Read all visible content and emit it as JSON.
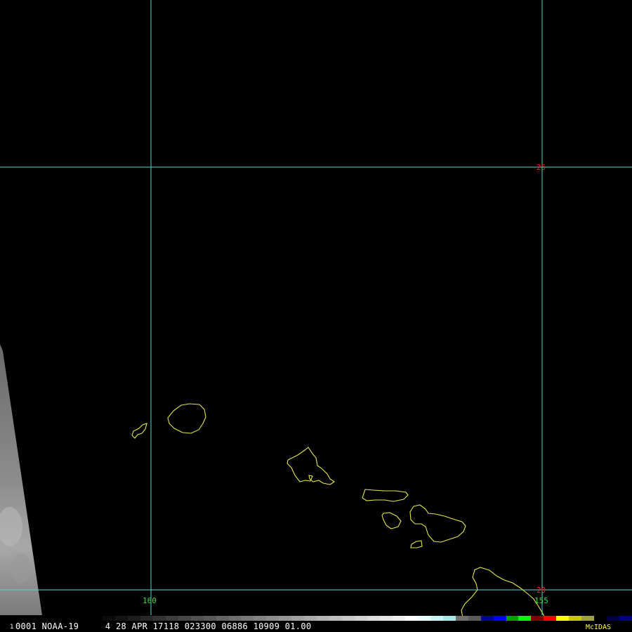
{
  "image": {
    "type": "McIDAS satellite image",
    "background": "#000000",
    "grid_color": "#4fd8d8",
    "coast_color": "#e6e64a",
    "cloud_color": "#8a8a8a"
  },
  "grid": {
    "latitudes": [
      {
        "label": "25",
        "label_color": "#ff2020"
      },
      {
        "label": "20",
        "label_color": "#ff2020"
      }
    ],
    "longitudes": [
      {
        "label": "160",
        "label_color": "#30e030"
      },
      {
        "label": "155",
        "label_color": "#30e030"
      }
    ]
  },
  "islands": [
    "Niihau",
    "Kauai",
    "Oahu",
    "Molokai",
    "Lanai",
    "Maui",
    "Kahoolawe",
    "Hawaii"
  ],
  "status_bar": {
    "frame": "1",
    "text": "0001 NOAA-19     4 28 APR 17118 023300 06886 10909 01.00",
    "brand": "McIDAS",
    "brand_color": "#ffff40"
  },
  "colorbar": [
    "#0a0a0a",
    "#141414",
    "#1e1e1e",
    "#282828",
    "#323232",
    "#3c3c3c",
    "#464646",
    "#505050",
    "#5a5a5a",
    "#646464",
    "#6e6e6e",
    "#787878",
    "#828282",
    "#8c8c8c",
    "#969696",
    "#a0a0a0",
    "#aaaaaa",
    "#b4b4b4",
    "#bebebe",
    "#c8c8c8",
    "#d2d2d2",
    "#dcdcdc",
    "#e6e6e6",
    "#f0f0f0",
    "#ffffff",
    "#e8ffff",
    "#c8f4f4",
    "#a8e8e8",
    "#707070",
    "#5a5a5a",
    "#0000a0",
    "#0000ff",
    "#00a000",
    "#00ff00",
    "#800000",
    "#ff0000",
    "#ffff00",
    "#c8c800",
    "#a0a040",
    "#000000",
    "#000040",
    "#000080"
  ]
}
